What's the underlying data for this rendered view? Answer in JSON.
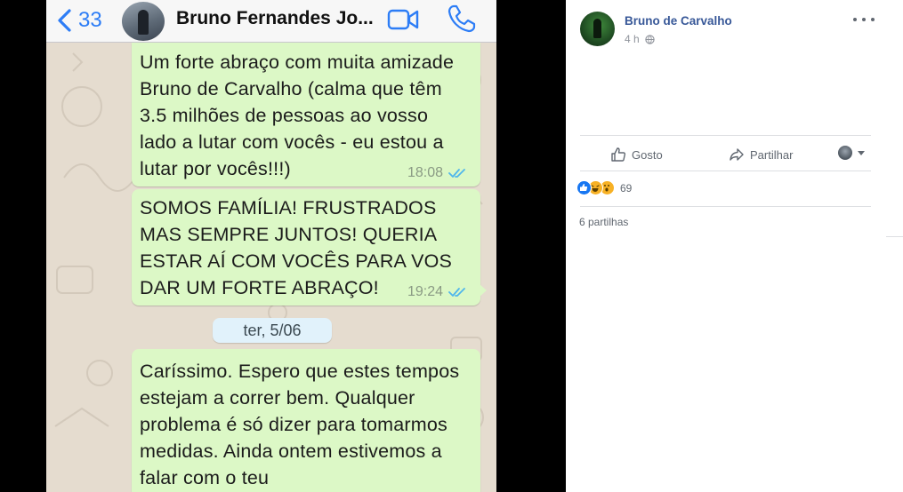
{
  "whatsapp": {
    "back_count": "33",
    "contact_name": "Bruno Fernandes Jo...",
    "messages": [
      {
        "text": "Um forte abraço com muita amizade Bruno de Carvalho (calma que têm 3.5 milhões de pessoas ao vosso lado a lutar com vocês - eu estou a lutar por vocês!!!)",
        "time": "18:08"
      },
      {
        "text": "SOMOS FAMÍLIA! FRUSTRADOS MAS SEMPRE JUNTOS! QUERIA ESTAR AÍ COM VOCÊS PARA VOS DAR UM FORTE ABRAÇO!",
        "time": "19:24"
      },
      {
        "text": "Caríssimo. Espero que estes tempos estejam a correr bem. Qualquer problema é só dizer para tomarmos medidas. Ainda ontem estivemos a falar com o teu",
        "time": ""
      }
    ],
    "date_separator": "ter, 5/06",
    "colors": {
      "accent": "#2d7df6",
      "bubble": "#dcf8c6",
      "read_ticks": "#4fb6ec"
    },
    "icons": [
      "chevron-left-icon",
      "video-call-icon",
      "phone-icon",
      "double-check-icon"
    ]
  },
  "facebook": {
    "author": "Bruno de Carvalho",
    "time": "4 h",
    "privacy_icon": "globe-icon",
    "actions": {
      "like": "Gosto",
      "share": "Partilhar"
    },
    "reaction_count": "69",
    "reactions": [
      "like",
      "haha",
      "wow"
    ],
    "shares": "6 partilhas",
    "colors": {
      "name": "#385898",
      "text": "#606770",
      "like": "#1877f2"
    }
  }
}
